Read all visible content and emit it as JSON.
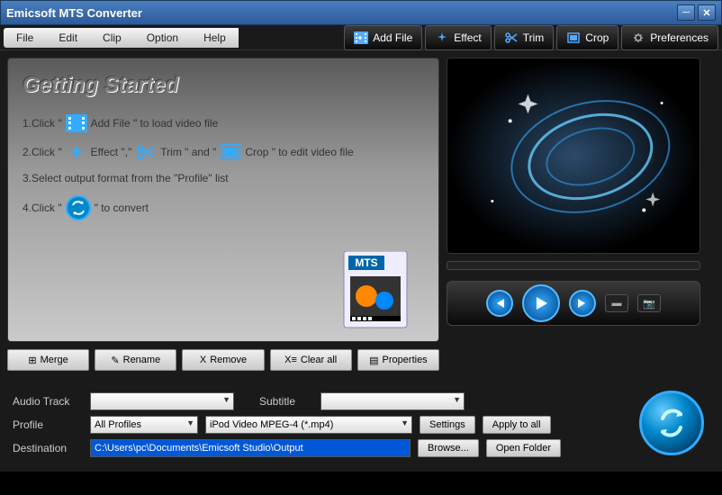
{
  "window": {
    "title": "Emicsoft MTS Converter"
  },
  "menu": {
    "file": "File",
    "edit": "Edit",
    "clip": "Clip",
    "option": "Option",
    "help": "Help"
  },
  "toolbar": {
    "addfile": "Add File",
    "effect": "Effect",
    "trim": "Trim",
    "crop": "Crop",
    "preferences": "Preferences"
  },
  "guide": {
    "title": "Getting Started",
    "step1a": "1.Click \"",
    "step1b": "Add File \"  to load video file",
    "step2a": "2.Click \"",
    "step2b": "Effect \",\"",
    "step2c": "Trim \" and \"",
    "step2d": "Crop \" to edit video file",
    "step3": "3.Select output format from the \"Profile\" list",
    "step4a": "4.Click \"",
    "step4b": "\" to convert",
    "mts_label": "MTS"
  },
  "actions": {
    "merge": "Merge",
    "rename": "Rename",
    "remove": "Remove",
    "clearall": "Clear all",
    "properties": "Properties"
  },
  "form": {
    "audiotrack_label": "Audio Track",
    "audiotrack_value": "",
    "subtitle_label": "Subtitle",
    "subtitle_value": "",
    "profile_label": "Profile",
    "profile_category": "All Profiles",
    "profile_value": "iPod Video MPEG-4 (*.mp4)",
    "destination_label": "Destination",
    "destination_value": "C:\\Users\\pc\\Documents\\Emicsoft Studio\\Output",
    "settings": "Settings",
    "applyall": "Apply to all",
    "browse": "Browse...",
    "openfolder": "Open Folder"
  }
}
